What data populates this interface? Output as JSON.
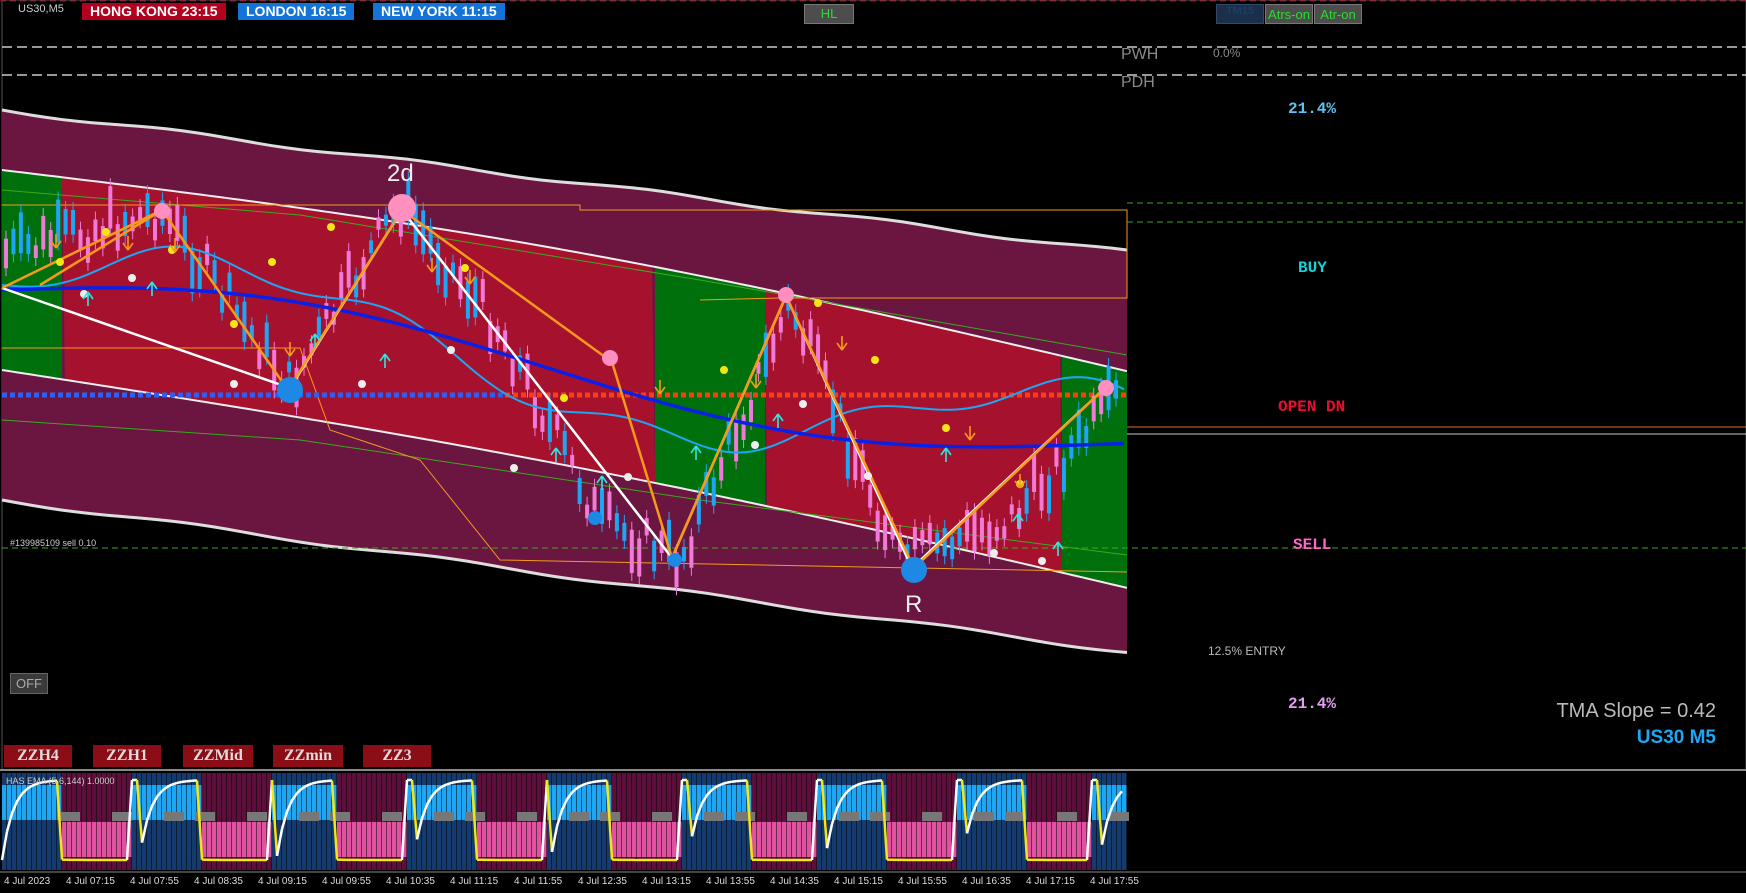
{
  "header": {
    "symbol": "US30,M5",
    "sessions": [
      {
        "name": "HONG KONG",
        "time": "23:15",
        "color": "#b3001e"
      },
      {
        "name": "LONDON",
        "time": "16:15",
        "color": "#1473d9"
      },
      {
        "name": "NEW YORK",
        "time": "11:15",
        "color": "#1473d9"
      }
    ],
    "hl_button": "HL",
    "tm_button": "TM15",
    "atr_buttons": [
      "Atrs-on",
      "Atr-on"
    ]
  },
  "levels": {
    "pwh": "PWH",
    "pdh": "PDH",
    "zero_pct": "0.0%",
    "fib_top": "21.4%",
    "buy": "BUY",
    "open_dn": "OPEN DN",
    "sell": "SELL",
    "entry": "12.5% ENTRY",
    "fib_bottom": "21.4%"
  },
  "order_label": "#139985109 sell 0.10",
  "wave_labels": {
    "top": "2d",
    "bottom": "R"
  },
  "info": {
    "tma_slope": "TMA Slope = 0.42",
    "symbol_tf": "US30 M5"
  },
  "off_button": "OFF",
  "zz_buttons": [
    "ZZH4",
    "ZZH1",
    "ZZMid",
    "ZZmin",
    "ZZ3"
  ],
  "subwindow": {
    "title": "HAS EMA (5,6,144) 1.0000"
  },
  "colors": {
    "buy": "#19d1d8",
    "open_dn": "#e8102f",
    "sell": "#ff66cc",
    "fib": "#5bc4f5",
    "fib_bottom": "#e79df5",
    "band_outer": "#6b1640",
    "band_inner_bear": "#a6122e",
    "band_inner_bull": "#00700d",
    "zigzag_orange": "#f59a1a",
    "zigzag_white": "#ffffff",
    "tma": "#0a20e6",
    "ema": "#1ea6f5"
  },
  "chart_data": {
    "type": "line",
    "title": "",
    "x_ticks": [
      "4 Jul 2023",
      "4 Jul 07:15",
      "4 Jul 07:55",
      "4 Jul 08:35",
      "4 Jul 09:15",
      "4 Jul 09:55",
      "4 Jul 10:35",
      "4 Jul 11:15",
      "4 Jul 11:55",
      "4 Jul 12:35",
      "4 Jul 13:15",
      "4 Jul 13:55",
      "4 Jul 14:35",
      "4 Jul 15:15",
      "4 Jul 15:55",
      "4 Jul 16:35",
      "4 Jul 17:15",
      "4 Jul 17:55"
    ],
    "series": [],
    "grid": false,
    "legend": "none"
  }
}
